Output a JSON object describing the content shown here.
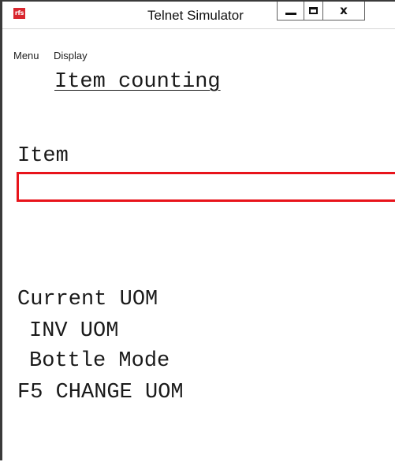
{
  "window": {
    "title": "Telnet Simulator",
    "logo_text": "rfs",
    "close_glyph": "x"
  },
  "menu": {
    "items": [
      "Menu",
      "Display"
    ]
  },
  "screen": {
    "heading": "Item counting",
    "item_label": "Item",
    "item_value": "",
    "current_uom_label": "Current UOM",
    "inv_uom": "INV UOM",
    "bottle_mode": "Bottle Mode",
    "f5_hint": "F5 CHANGE UOM"
  },
  "colors": {
    "input_border": "#e8141b",
    "logo_bg": "#d9262e"
  }
}
